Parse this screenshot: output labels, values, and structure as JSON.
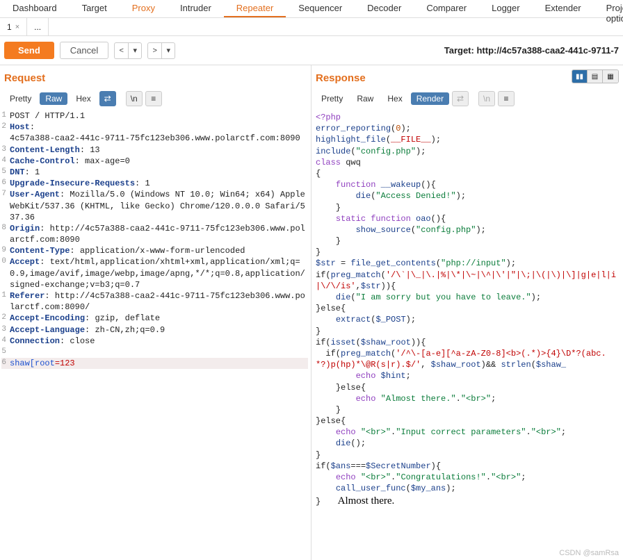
{
  "topTabs": [
    "Dashboard",
    "Target",
    "Proxy",
    "Intruder",
    "Repeater",
    "Sequencer",
    "Decoder",
    "Comparer",
    "Logger",
    "Extender",
    "Project optio"
  ],
  "topTabHighlight": "Proxy",
  "topTabActive": "Repeater",
  "subTabs": [
    {
      "label": "1",
      "closeable": true
    },
    {
      "label": "...",
      "closeable": false
    }
  ],
  "actions": {
    "send": "Send",
    "cancel": "Cancel",
    "targetPrefix": "Target: ",
    "targetValue": "http://4c57a388-caa2-441c-9711-7"
  },
  "request": {
    "title": "Request",
    "viewTabs": [
      "Pretty",
      "Raw",
      "Hex"
    ],
    "viewActive": "Raw",
    "lines": [
      {
        "n": "1",
        "type": "plain",
        "text": "POST / HTTP/1.1"
      },
      {
        "n": "2",
        "type": "header",
        "name": "Host",
        "value": "4c57a388-caa2-441c-9711-75fc123eb306.www.polarctf.com:8090",
        "wrap": true
      },
      {
        "n": "3",
        "type": "header",
        "name": "Content-Length",
        "value": "13"
      },
      {
        "n": "4",
        "type": "header",
        "name": "Cache-Control",
        "value": "max-age=0"
      },
      {
        "n": "5",
        "type": "header",
        "name": "DNT",
        "value": "1"
      },
      {
        "n": "6",
        "type": "header",
        "name": "Upgrade-Insecure-Requests",
        "value": "1"
      },
      {
        "n": "7",
        "type": "header",
        "name": "User-Agent",
        "value": "Mozilla/5.0 (Windows NT 10.0; Win64; x64) AppleWebKit/537.36 (KHTML, like Gecko) Chrome/120.0.0.0 Safari/537.36"
      },
      {
        "n": "8",
        "type": "header",
        "name": "Origin",
        "value": "http://4c57a388-caa2-441c-9711-75fc123eb306.www.polarctf.com:8090"
      },
      {
        "n": "9",
        "type": "header",
        "name": "Content-Type",
        "value": "application/x-www-form-urlencoded"
      },
      {
        "n": "0",
        "type": "header",
        "name": "Accept",
        "value": "text/html,application/xhtml+xml,application/xml;q=0.9,image/avif,image/webp,image/apng,*/*;q=0.8,application/signed-exchange;v=b3;q=0.7"
      },
      {
        "n": "1",
        "type": "header",
        "name": "Referer",
        "value": "http://4c57a388-caa2-441c-9711-75fc123eb306.www.polarctf.com:8090/"
      },
      {
        "n": "2",
        "type": "header",
        "name": "Accept-Encoding",
        "value": "gzip, deflate"
      },
      {
        "n": "3",
        "type": "header",
        "name": "Accept-Language",
        "value": "zh-CN,zh;q=0.9"
      },
      {
        "n": "4",
        "type": "header",
        "name": "Connection",
        "value": "close"
      },
      {
        "n": "5",
        "type": "blank",
        "text": ""
      },
      {
        "n": "6",
        "type": "body",
        "key": "shaw[root",
        "sep": "=",
        "val": "123"
      }
    ]
  },
  "response": {
    "title": "Response",
    "viewTabs": [
      "Pretty",
      "Raw",
      "Hex",
      "Render"
    ],
    "viewActive": "Render",
    "renderedTail": "Almost there.",
    "code": {
      "l1": {
        "a": "<?php"
      },
      "l2": {
        "a": "error_reporting",
        "b": "(",
        "c": "0",
        "d": ");"
      },
      "l3": {
        "a": "highlight_file",
        "b": "(",
        "c": "__FILE__",
        "d": ");"
      },
      "l4": {
        "a": "include",
        "b": "(",
        "c": "\"config.php\"",
        "d": ");"
      },
      "l5": {
        "a": "class ",
        "b": "qwq"
      },
      "l6": {
        "a": "{"
      },
      "l7": {
        "a": "    function ",
        "b": "__wakeup",
        "c": "(){"
      },
      "l8": {
        "a": "        die",
        "b": "(",
        "c": "\"Access Denied!\"",
        "d": ");"
      },
      "l9": {
        "a": "    }"
      },
      "l10": {
        "a": "    static function ",
        "b": "oao",
        "c": "(){"
      },
      "l11": {
        "a": "        show_source",
        "b": "(",
        "c": "\"config.php\"",
        "d": ");"
      },
      "l12": {
        "a": "    }"
      },
      "l13": {
        "a": "}"
      },
      "l14": {
        "a": "$str ",
        "b": "= ",
        "c": "file_get_contents",
        "d": "(",
        "e": "\"php://input\"",
        "f": ");"
      },
      "l15": {
        "a": "if(",
        "b": "preg_match",
        "c": "(",
        "d": "'/\\`|\\_|\\.|%|\\*|\\~|\\^|\\'|\"|\\;|\\(|\\)|\\]|g|e|l|i|\\/\\/is'",
        "e": ",",
        "f": "$str",
        "g": ")){"
      },
      "l16": {
        "a": "    die",
        "b": "(",
        "c": "\"I am sorry but you have to leave.\"",
        "d": ");"
      },
      "l17": {
        "a": "}else{"
      },
      "l18": {
        "a": "    extract",
        "b": "(",
        "c": "$_POST",
        "d": ");"
      },
      "l19": {
        "a": "}"
      },
      "l20": {
        "a": "if(",
        "b": "isset",
        "c": "(",
        "d": "$shaw_root",
        "e": ")){"
      },
      "l21": {
        "a": "  if(",
        "b": "preg_match",
        "c": "(",
        "d": "'/^\\-[a-e][^a-zA-Z0-8]<b>(.*)>{4}\\D*?(abc.*?)p(hp)*\\@R(s|r).$/'",
        "e": ", ",
        "f": "$shaw_root",
        "g": ")&& ",
        "h": "strlen",
        "i": "(",
        "j": "$shaw_"
      },
      "l22": {
        "a": "        echo ",
        "b": "$hint",
        ";": ";"
      },
      "l23": {
        "a": "    }else{"
      },
      "l24": {
        "a": "        echo ",
        "b": "\"Almost there.\"",
        "c": ".",
        "d": "\"<br>\"",
        "e": ";"
      },
      "l25": {
        "a": "    }"
      },
      "l26": {
        "a": "}else{"
      },
      "l27": {
        "a": "    echo ",
        "b": "\"<br>\"",
        "c": ".",
        "d": "\"Input correct parameters\"",
        "e": ".",
        "f": "\"<br>\"",
        "g": ";"
      },
      "l28": {
        "a": "    die",
        "b": "();"
      },
      "l29": {
        "a": "}"
      },
      "l30": {
        "a": "if(",
        "b": "$ans",
        "c": "===",
        "d": "$SecretNumber",
        "e": "){"
      },
      "l31": {
        "a": "    echo ",
        "b": "\"<br>\"",
        "c": ".",
        "d": "\"Congratulations!\"",
        "e": ".",
        "f": "\"<br>\"",
        "g": ";"
      },
      "l32": {
        "a": "    call_user_func",
        "b": "(",
        "c": "$my_ans",
        "d": ");"
      },
      "l33": {
        "a": "}"
      }
    }
  },
  "watermark": "CSDN @samRsa"
}
